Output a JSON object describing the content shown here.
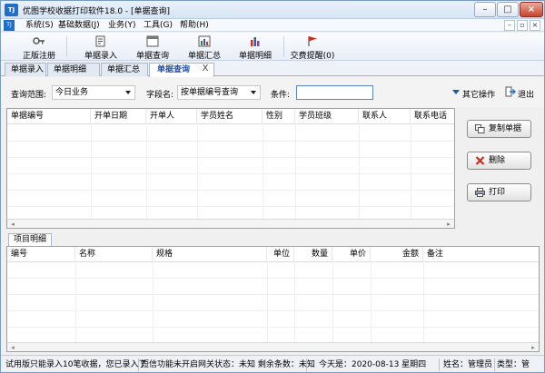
{
  "window": {
    "app_icon_text": "TJ",
    "title": "优图学校收据打印软件18.0 - [单据查询]",
    "minimize": "–",
    "maximize": "□",
    "close": "×"
  },
  "menubar": {
    "items": [
      "系统(S)",
      "基础数据(J)",
      "业务(Y)",
      "工具(G)",
      "帮助(H)"
    ],
    "mdi_controls": [
      "–",
      "▫",
      "×"
    ]
  },
  "toolbar": {
    "buttons": [
      "正版注册",
      "单据录入",
      "单据查询",
      "单据汇总",
      "单据明细",
      "交费提醒(0)"
    ]
  },
  "tabs": {
    "items": [
      "单据录入",
      "单据明细",
      "单据汇总",
      "单据查询"
    ],
    "active": "单据查询",
    "close": "X"
  },
  "filter": {
    "range_label": "查询范围:",
    "range_value": "今日业务",
    "field_label": "字段名:",
    "field_value": "按单据编号查询",
    "condition_label": "条件:",
    "condition_value": "",
    "other_ops": "其它操作",
    "exit": "退出"
  },
  "main_table": {
    "columns": [
      "单据编号",
      "开单日期",
      "开单人",
      "学员姓名",
      "性别",
      "学员班级",
      "联系人",
      "联系电话"
    ]
  },
  "side_buttons": {
    "copy": "复制单据",
    "delete": "删除",
    "print": "打印"
  },
  "detail": {
    "tab": "项目明细",
    "columns": [
      "编号",
      "名称",
      "规格",
      "单位",
      "数量",
      "单价",
      "金额",
      "备注"
    ]
  },
  "statusbar": {
    "trial": "试用版只能录入10笔收据，您已录入了",
    "sms": "短信功能未开启网关状态：未知 剩余条数：未知",
    "today": "今天是：2020-08-13 星期四",
    "user": "姓名：管理员",
    "type": "类型：管"
  },
  "colors": {
    "accent": "#1e6fc9",
    "active_tab_text": "#1f4ea5",
    "delete_red": "#d42a1c"
  }
}
